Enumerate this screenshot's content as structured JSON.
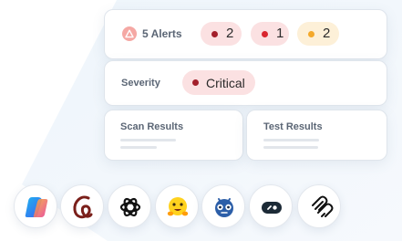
{
  "colors": {
    "alert_icon_bg": "#f5a8a4",
    "critical_dot": "#a31f2b",
    "high_dot": "#d9262f",
    "medium_dot": "#f4a92b",
    "red_pill_bg": "#fbe1e2",
    "amber_pill_bg": "#fdf0d8"
  },
  "alerts": {
    "icon": "warning-triangle-icon",
    "label": "5 Alerts",
    "badges": [
      {
        "count": "2",
        "color": "#a31f2b"
      },
      {
        "count": "1",
        "color": "#d9262f"
      },
      {
        "count": "2",
        "color": "#f4a92b"
      }
    ]
  },
  "severity": {
    "label": "Severity",
    "value": "Critical"
  },
  "panels": {
    "scan_results": "Scan Results",
    "test_results": "Test Results"
  },
  "integrations": [
    {
      "icon": "copilot-icon"
    },
    {
      "icon": "claude-script-icon"
    },
    {
      "icon": "openai-icon"
    },
    {
      "icon": "hugging-face-icon"
    },
    {
      "icon": "robot-icon"
    },
    {
      "icon": "pill-link-icon"
    },
    {
      "icon": "loop-icon"
    }
  ]
}
